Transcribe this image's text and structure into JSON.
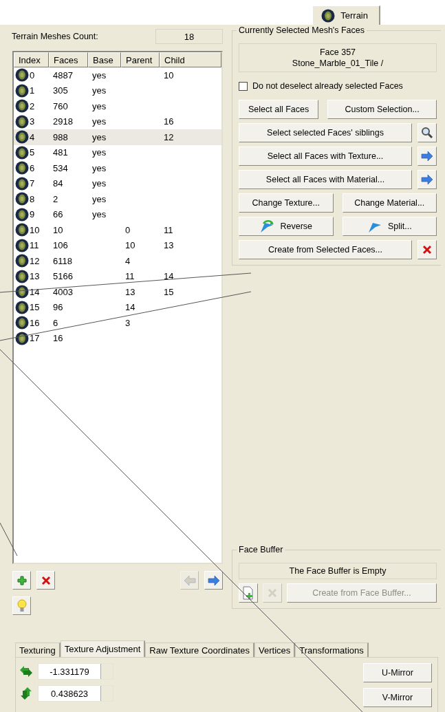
{
  "top_tabs": [
    {
      "label": "Terrain",
      "selected": true
    }
  ],
  "mesh_count": {
    "label": "Terrain Meshes Count:",
    "value": "18"
  },
  "table": {
    "columns": [
      "Index",
      "Faces",
      "Base",
      "Parent",
      "Child"
    ],
    "rows": [
      {
        "cells": [
          "0",
          "4887",
          "yes",
          "",
          "10"
        ],
        "selected": false
      },
      {
        "cells": [
          "1",
          "305",
          "yes",
          "",
          ""
        ],
        "selected": false
      },
      {
        "cells": [
          "2",
          "760",
          "yes",
          "",
          ""
        ],
        "selected": false
      },
      {
        "cells": [
          "3",
          "2918",
          "yes",
          "",
          "16"
        ],
        "selected": false
      },
      {
        "cells": [
          "4",
          "988",
          "yes",
          "",
          "12"
        ],
        "selected": true
      },
      {
        "cells": [
          "5",
          "481",
          "yes",
          "",
          ""
        ],
        "selected": false
      },
      {
        "cells": [
          "6",
          "534",
          "yes",
          "",
          ""
        ],
        "selected": false
      },
      {
        "cells": [
          "7",
          "84",
          "yes",
          "",
          ""
        ],
        "selected": false
      },
      {
        "cells": [
          "8",
          "2",
          "yes",
          "",
          ""
        ],
        "selected": false
      },
      {
        "cells": [
          "9",
          "66",
          "yes",
          "",
          ""
        ],
        "selected": false
      },
      {
        "cells": [
          "10",
          "10",
          "",
          "0",
          "11"
        ],
        "selected": false
      },
      {
        "cells": [
          "11",
          "106",
          "",
          "10",
          "13"
        ],
        "selected": false
      },
      {
        "cells": [
          "12",
          "6118",
          "",
          "4",
          ""
        ],
        "selected": false
      },
      {
        "cells": [
          "13",
          "5166",
          "",
          "11",
          "14"
        ],
        "selected": false
      },
      {
        "cells": [
          "14",
          "4003",
          "",
          "13",
          "15"
        ],
        "selected": false
      },
      {
        "cells": [
          "15",
          "96",
          "",
          "14",
          ""
        ],
        "selected": false
      },
      {
        "cells": [
          "16",
          "6",
          "",
          "3",
          ""
        ],
        "selected": false
      },
      {
        "cells": [
          "17",
          "16",
          "",
          "",
          ""
        ],
        "selected": false
      }
    ]
  },
  "list_buttons": {
    "previous_disabled": true,
    "next_disabled": false
  },
  "faces_group": {
    "title": "Currently Selected Mesh's Faces",
    "info": [
      "Face 357",
      "Stone_Marble_01_Tile /"
    ],
    "checkbox": {
      "label": "Do not deselect already selected Faces",
      "checked": false
    },
    "buttons": [
      "Select all Faces",
      "Custom Selection...",
      "Select selected Faces' siblings",
      "Select all Faces with Texture...",
      "Select all Faces with Material...",
      "Change Texture...",
      "Change Material...",
      "Reverse",
      "Split...",
      "Create from Selected Faces..."
    ]
  },
  "face_buffer": {
    "title": "Face Buffer",
    "status": "The Face Buffer is Empty",
    "remove_disabled": true,
    "create": {
      "label": "Create from Face Buffer...",
      "disabled": true
    }
  },
  "bottom_tabs": [
    {
      "label": "Texturing",
      "selected": false
    },
    {
      "label": "Texture Adjustment",
      "selected": true
    },
    {
      "label": "Raw Texture Coordinates",
      "selected": false
    },
    {
      "label": "Vertices",
      "selected": false
    },
    {
      "label": "Transformations",
      "selected": false
    }
  ],
  "adjustment": {
    "u_value": "-1.331179",
    "v_value": "0.438623",
    "u_button": "U-Mirror",
    "v_button": "V-Mirror"
  }
}
